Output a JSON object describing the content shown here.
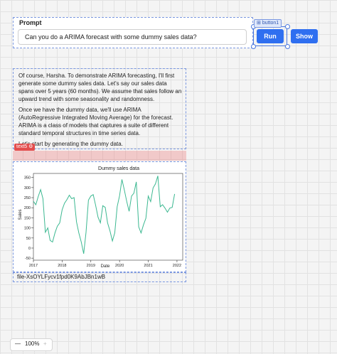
{
  "prompt_panel": {
    "label": "Prompt",
    "input_value": "Can you do a ARIMA forecast with some dummy sales data?",
    "run_label": "Run",
    "show_label": "Show",
    "run_tag": "button1"
  },
  "response": {
    "tag": "text5",
    "paragraphs": [
      "Of course, Harsha. To demonstrate ARIMA forecasting, I'll first generate some dummy sales data. Let's say our sales data spans over 5 years (60 months). We assume that sales follow an upward trend with some seasonality and randomness.",
      "Once we have the dummy data, we'll use ARIMA (AutoRegressive Integrated Moving Average) for the forecast. ARIMA is a class of models that captures a suite of different standard temporal structures in time series data.",
      "Let's start by generating the dummy data."
    ]
  },
  "file_name": "file-XsOYLFycv1fpd0K9AbJBn1wB",
  "zoom": {
    "minus": "—",
    "level": "100%",
    "plus": "+"
  },
  "colors": {
    "accent": "#2f6ff0",
    "line": "#3cb891",
    "selection": "#7a97e0"
  },
  "chart_data": {
    "type": "line",
    "title": "Dummy sales data",
    "xlabel": "Date",
    "ylabel": "Sales",
    "ylim": [
      -60,
      370
    ],
    "xlim": [
      2017.0,
      2022.2
    ],
    "grid": false,
    "xticks": [
      2017,
      2018,
      2019,
      2020,
      2021,
      2022
    ],
    "yticks": [
      -50,
      0,
      50,
      100,
      150,
      200,
      250,
      300,
      350
    ],
    "series": [
      {
        "x": [
          2017.0,
          2017.083,
          2017.167,
          2017.25,
          2017.333,
          2017.417,
          2017.5,
          2017.583,
          2017.667,
          2017.75,
          2017.833,
          2017.917,
          2018.0,
          2018.083,
          2018.167,
          2018.25,
          2018.333,
          2018.417,
          2018.5,
          2018.583,
          2018.667,
          2018.75,
          2018.833,
          2018.917,
          2019.0,
          2019.083,
          2019.167,
          2019.25,
          2019.333,
          2019.417,
          2019.5,
          2019.583,
          2019.667,
          2019.75,
          2019.833,
          2019.917,
          2020.0,
          2020.083,
          2020.167,
          2020.25,
          2020.333,
          2020.417,
          2020.5,
          2020.583,
          2020.667,
          2020.75,
          2020.833,
          2020.917,
          2021.0,
          2021.083,
          2021.167,
          2021.25,
          2021.333,
          2021.417,
          2021.5,
          2021.583,
          2021.667,
          2021.75,
          2021.833,
          2021.917
        ],
        "values": [
          232,
          215,
          255,
          290,
          245,
          78,
          100,
          38,
          30,
          75,
          108,
          125,
          190,
          222,
          240,
          262,
          245,
          250,
          130,
          75,
          30,
          -28,
          78,
          238,
          258,
          265,
          212,
          153,
          125,
          210,
          202,
          125,
          85,
          35,
          75,
          205,
          260,
          340,
          288,
          232,
          182,
          258,
          272,
          328,
          105,
          75,
          115,
          148,
          258,
          230,
          298,
          318,
          358,
          205,
          215,
          198,
          178,
          198,
          202,
          268
        ]
      }
    ]
  }
}
